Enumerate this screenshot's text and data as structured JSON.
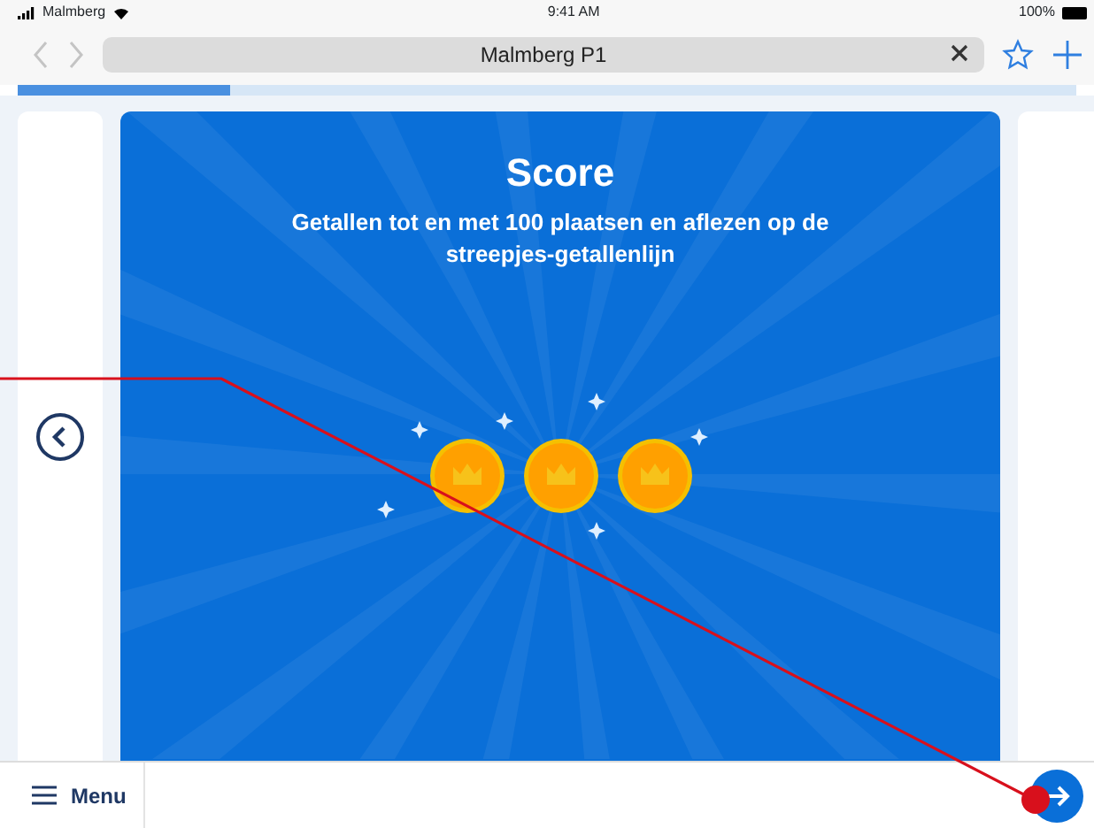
{
  "status_bar": {
    "carrier": "Malmberg",
    "time": "9:41 AM",
    "battery": "100%"
  },
  "address_bar": {
    "title": "Malmberg P1"
  },
  "progress": {
    "level": 0.2
  },
  "score": {
    "title": "Score",
    "subtitle": "Getallen tot en met 100 plaatsen en aflezen op de streepjes-getallenlijn",
    "stars": 3
  },
  "toolbar": {
    "menu_label": "Menu"
  }
}
